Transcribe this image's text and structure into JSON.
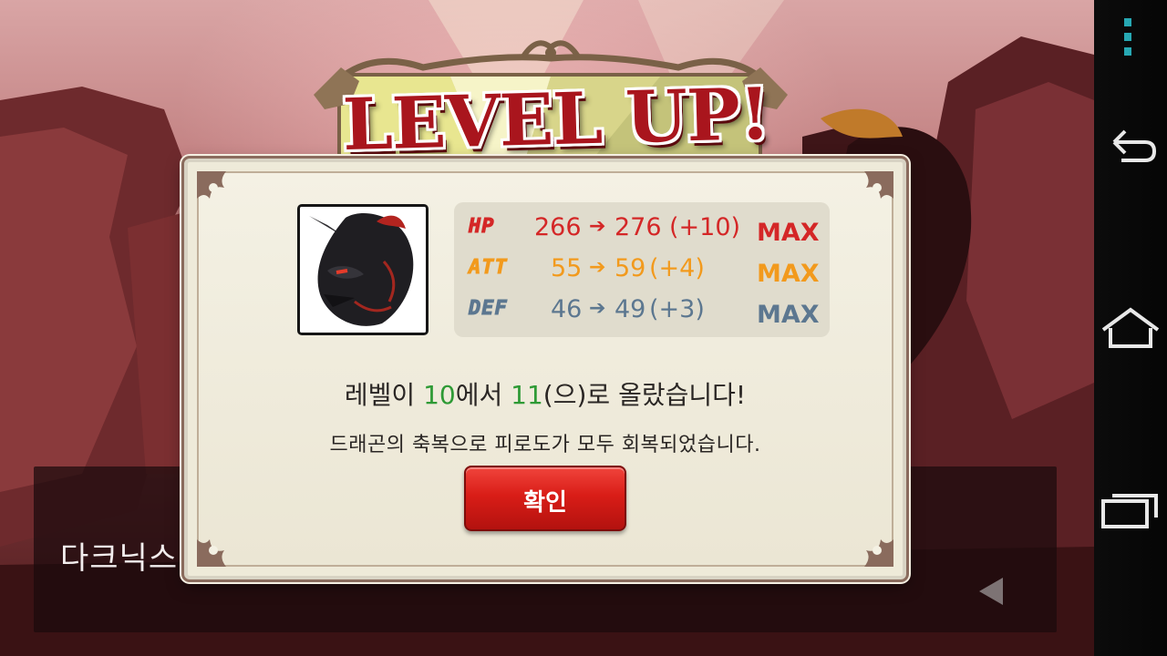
{
  "modal": {
    "title": "LEVEL UP!",
    "stats": [
      {
        "label": "HP",
        "old": "266",
        "new": "276",
        "diff": "(+10)",
        "max": "MAX",
        "color": "#d42727"
      },
      {
        "label": "ATT",
        "old": "55",
        "new": "59",
        "diff": "(+4)",
        "max": "MAX",
        "color": "#f29a1d"
      },
      {
        "label": "DEF",
        "old": "46",
        "new": "49",
        "diff": "(+3)",
        "max": "MAX",
        "color": "#5c7790"
      }
    ],
    "message_line1": {
      "prefix": "레벨이 ",
      "from_level": "10",
      "middle": "에서 ",
      "to_level": "11",
      "suffix": "(으)로 올랐습니다!"
    },
    "message_line2": "드래곤의 축복으로 피로도가 모두 회복되었습니다.",
    "confirm_label": "확인"
  },
  "dialogue": {
    "speaker_name": "다크닉스"
  },
  "colors": {
    "accent_red": "#d91d17",
    "level_green": "#2e9a35",
    "nav_icon_teal": "#27a8b3"
  },
  "icons": {
    "menu": "overflow-menu-icon",
    "back": "back-icon",
    "home": "home-icon",
    "recents": "recent-apps-icon"
  }
}
